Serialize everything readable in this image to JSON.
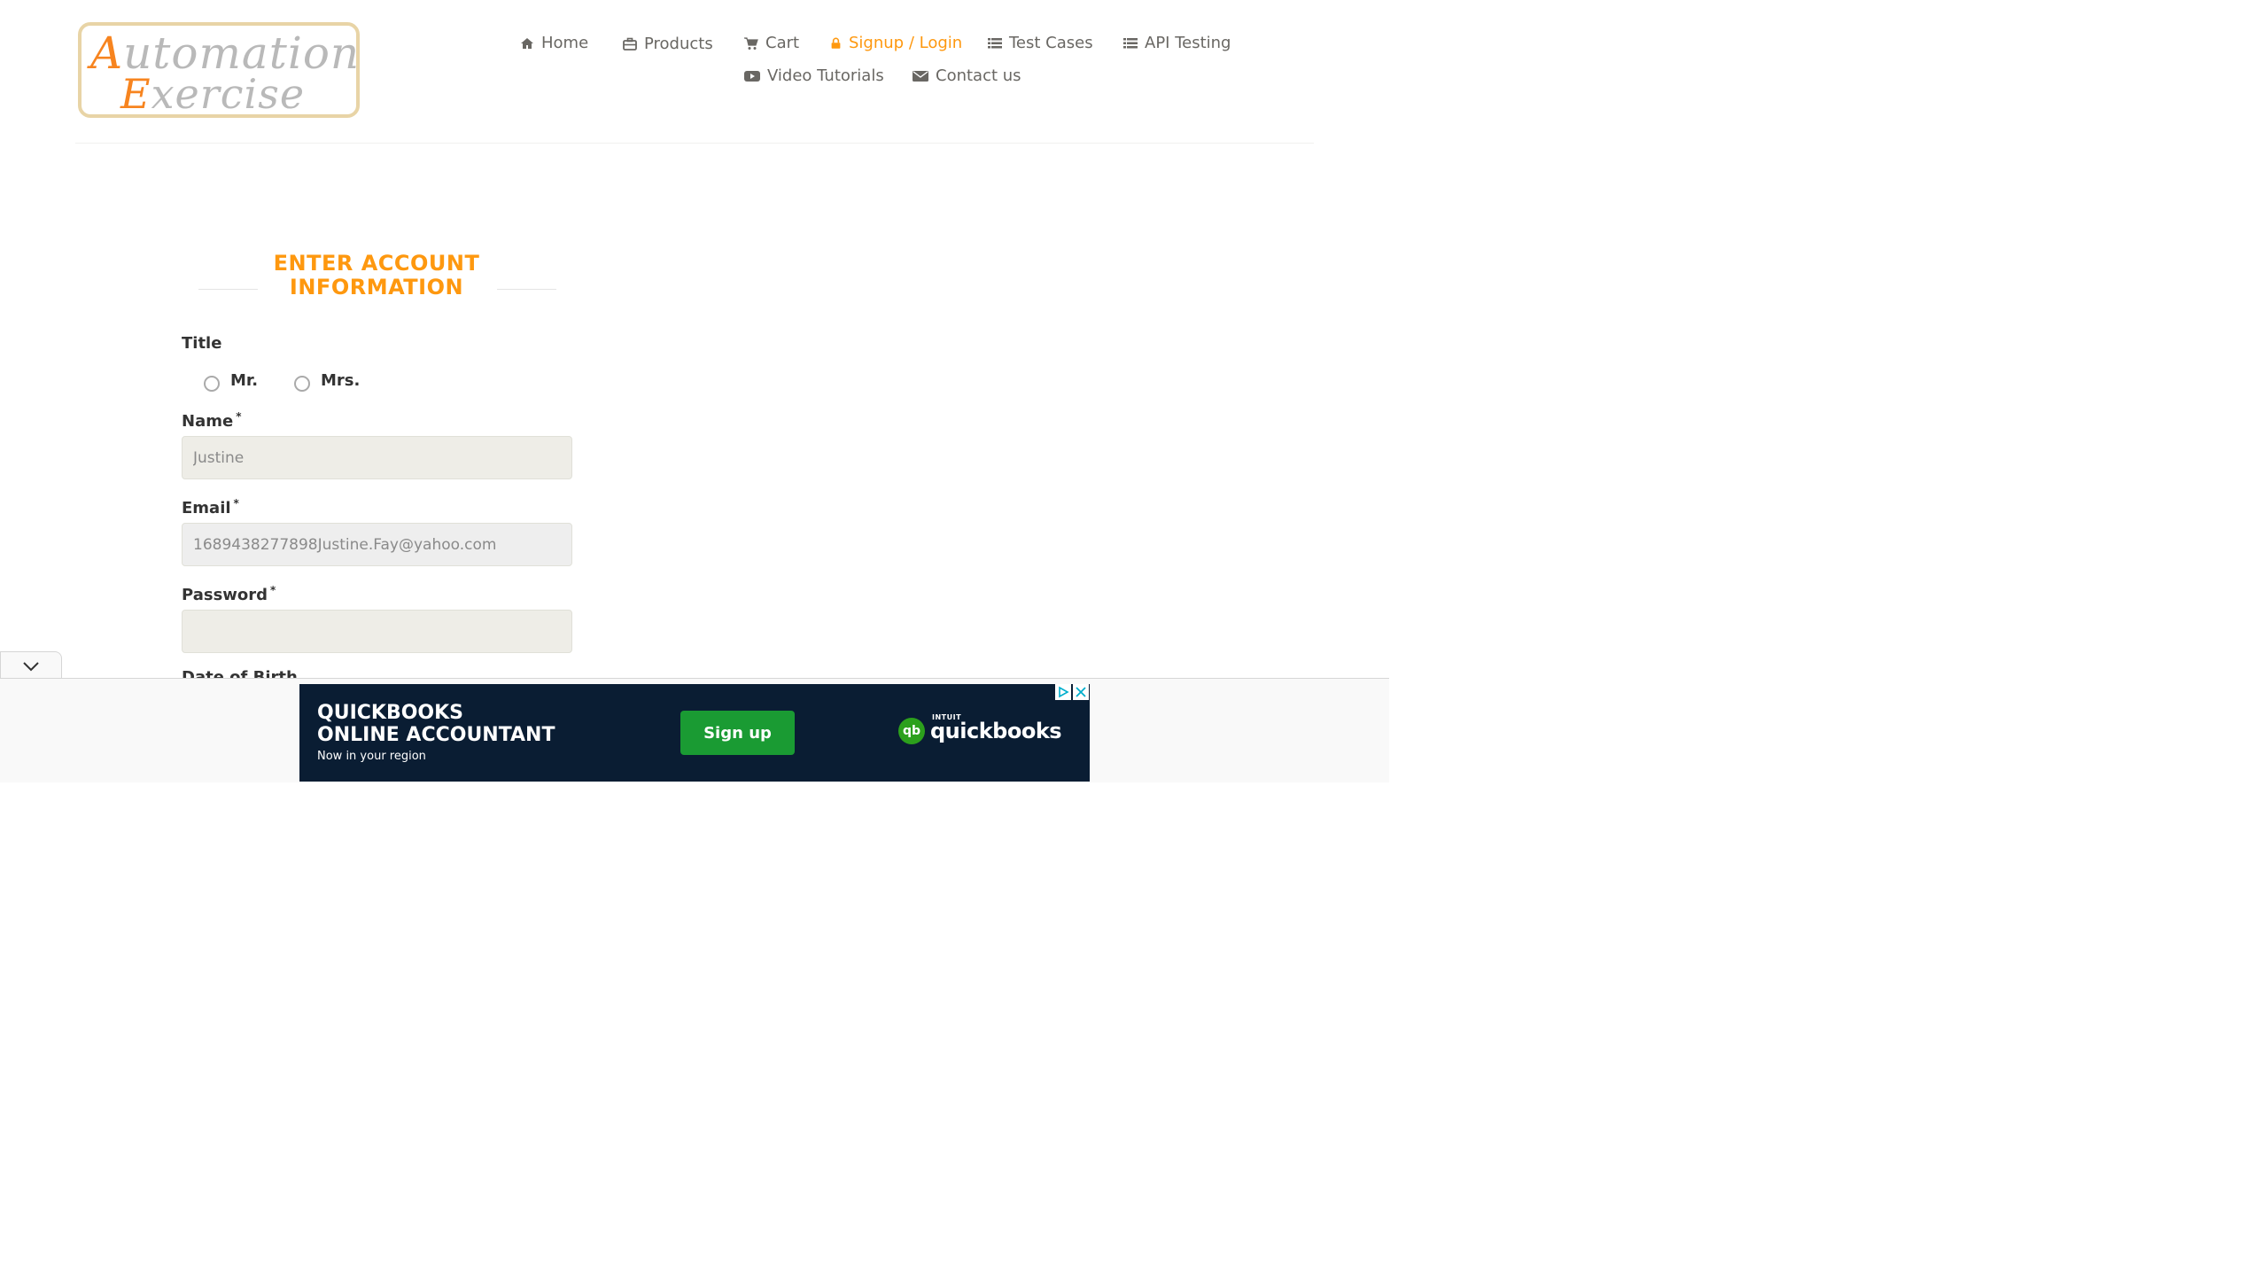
{
  "logo": {
    "line1_cap": "A",
    "line1_rest": "utomation",
    "line2_cap": "E",
    "line2_rest": "xercise"
  },
  "nav": {
    "items": [
      {
        "label": "Home",
        "icon": "home-icon"
      },
      {
        "label": "Products",
        "icon": "briefcase-icon"
      },
      {
        "label": "Cart",
        "icon": "cart-icon"
      },
      {
        "label": "Signup / Login",
        "icon": "lock-icon",
        "active": true
      },
      {
        "label": "Test Cases",
        "icon": "list-icon"
      },
      {
        "label": "API Testing",
        "icon": "list-icon"
      },
      {
        "label": "Video Tutorials",
        "icon": "youtube-play-icon"
      },
      {
        "label": "Contact us",
        "icon": "envelope-icon"
      }
    ]
  },
  "form": {
    "title": "ENTER ACCOUNT INFORMATION",
    "title_label": "Title",
    "title_options": [
      "Mr.",
      "Mrs."
    ],
    "name_label": "Name",
    "name_value": "Justine",
    "email_label": "Email",
    "email_value": "1689438277898Justine.Fay@yahoo.com",
    "password_label": "Password",
    "password_value": "",
    "required_mark": "*",
    "dob_label": "Date of Birth"
  },
  "ad": {
    "headline": "QUICKBOOKS\nONLINE ACCOUNTANT",
    "subline": "Now in your region",
    "cta": "Sign up",
    "brand_small": "INTUIT",
    "brand": "quickbooks",
    "brand_icon": "qb"
  },
  "colors": {
    "accent": "#fe980f",
    "nav_text": "#696763",
    "ad_bg": "#0a1d33",
    "ad_cta": "#1a9b33"
  }
}
